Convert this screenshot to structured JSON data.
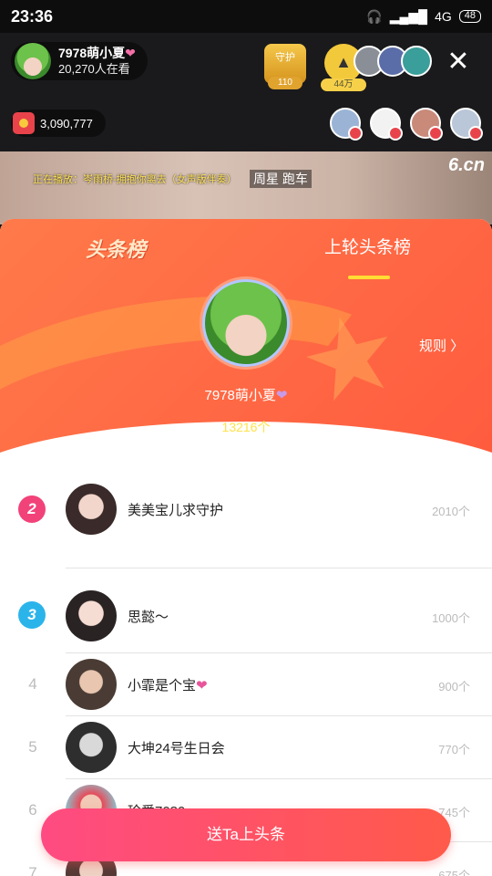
{
  "status_bar": {
    "time": "23:36",
    "network": "4G",
    "battery": "48"
  },
  "host": {
    "name": "7978萌小夏",
    "viewers": "20,270人在看"
  },
  "guard": {
    "label": "守护",
    "count": "110"
  },
  "fans": {
    "count": "44万"
  },
  "coins": {
    "value": "3,090,777"
  },
  "video": {
    "marquee": "正在播放：岑雨桥-拥抱你离去（女声版伴奏）",
    "song_tag": "周星 跑车",
    "logo": "6.cn"
  },
  "panel": {
    "tab_current": "头条榜",
    "tab_previous": "上轮头条榜",
    "winner_name": "7978萌小夏",
    "winner_count": "13216个",
    "rules_label": "规则"
  },
  "list": [
    {
      "rank": "2",
      "name": "美美宝儿求守护",
      "value": "2010个"
    },
    {
      "rank": "3",
      "name": "思懿～",
      "value": "1000个"
    },
    {
      "rank": "4",
      "name": "小霏是个宝",
      "value": "900个"
    },
    {
      "rank": "5",
      "name": "大坤24号生日会",
      "value": "770个"
    },
    {
      "rank": "6",
      "name": "珍爱7080",
      "value": "745个"
    },
    {
      "rank": "7",
      "name": "",
      "value": "675个"
    }
  ],
  "cta_label": "送Ta上头条",
  "colors": {
    "accent": "#ff5a4a",
    "gold": "#ffe24a",
    "rank2": "#f2427a",
    "rank3": "#2bb4ea"
  }
}
